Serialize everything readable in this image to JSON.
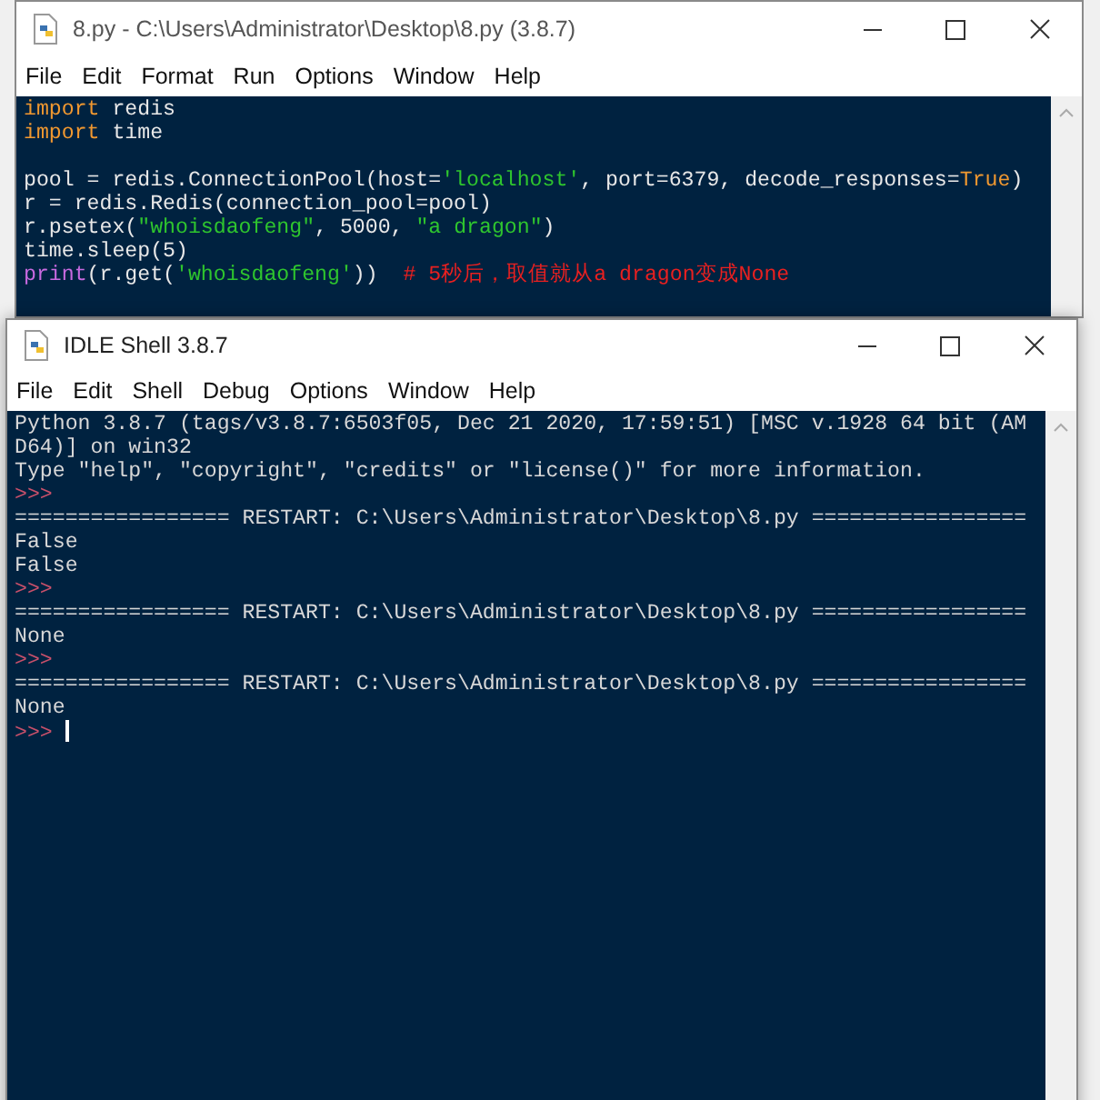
{
  "editor_window": {
    "title": "8.py - C:\\Users\\Administrator\\Desktop\\8.py (3.8.7)",
    "menu": [
      "File",
      "Edit",
      "Format",
      "Run",
      "Options",
      "Window",
      "Help"
    ],
    "code_lines": [
      {
        "kind": "code",
        "tokens": [
          {
            "kind": "keyword",
            "text": "import"
          },
          {
            "kind": "plain",
            "text": " redis"
          }
        ]
      },
      {
        "kind": "code",
        "tokens": [
          {
            "kind": "keyword",
            "text": "import"
          },
          {
            "kind": "plain",
            "text": " time"
          }
        ]
      },
      {
        "kind": "blank"
      },
      {
        "kind": "code",
        "tokens": [
          {
            "kind": "plain",
            "text": "pool = redis.ConnectionPool(host="
          },
          {
            "kind": "string",
            "text": "'localhost'"
          },
          {
            "kind": "plain",
            "text": ", port=6379, decode_responses="
          },
          {
            "kind": "keyword",
            "text": "True"
          },
          {
            "kind": "plain",
            "text": ")"
          }
        ]
      },
      {
        "kind": "code",
        "tokens": [
          {
            "kind": "plain",
            "text": "r = redis.Redis(connection_pool=pool)"
          }
        ]
      },
      {
        "kind": "code",
        "tokens": [
          {
            "kind": "plain",
            "text": "r.psetex("
          },
          {
            "kind": "string",
            "text": "\"whoisdaofeng\""
          },
          {
            "kind": "plain",
            "text": ", 5000, "
          },
          {
            "kind": "string",
            "text": "\"a dragon\""
          },
          {
            "kind": "plain",
            "text": ")"
          }
        ]
      },
      {
        "kind": "code",
        "tokens": [
          {
            "kind": "plain",
            "text": "time.sleep(5)"
          }
        ]
      },
      {
        "kind": "code",
        "tokens": [
          {
            "kind": "builtin",
            "text": "print"
          },
          {
            "kind": "plain",
            "text": "(r.get("
          },
          {
            "kind": "string",
            "text": "'whoisdaofeng'"
          },
          {
            "kind": "plain",
            "text": "))  "
          },
          {
            "kind": "comment",
            "text": "# 5秒后，取值就从a dragon变成None"
          }
        ]
      }
    ]
  },
  "shell_window": {
    "title": "IDLE Shell 3.8.7",
    "menu": [
      "File",
      "Edit",
      "Shell",
      "Debug",
      "Options",
      "Window",
      "Help"
    ],
    "lines": [
      {
        "kind": "output",
        "text": "Python 3.8.7 (tags/v3.8.7:6503f05, Dec 21 2020, 17:59:51) [MSC v.1928 64 bit (AM"
      },
      {
        "kind": "output",
        "text": "D64)] on win32"
      },
      {
        "kind": "output",
        "text": "Type \"help\", \"copyright\", \"credits\" or \"license()\" for more information."
      },
      {
        "kind": "prompt",
        "text": ">>>"
      },
      {
        "kind": "output",
        "text": "================= RESTART: C:\\Users\\Administrator\\Desktop\\8.py ================="
      },
      {
        "kind": "output",
        "text": "False"
      },
      {
        "kind": "output",
        "text": "False"
      },
      {
        "kind": "prompt",
        "text": ">>>"
      },
      {
        "kind": "output",
        "text": "================= RESTART: C:\\Users\\Administrator\\Desktop\\8.py ================="
      },
      {
        "kind": "output",
        "text": "None"
      },
      {
        "kind": "prompt",
        "text": ">>>"
      },
      {
        "kind": "output",
        "text": "================= RESTART: C:\\Users\\Administrator\\Desktop\\8.py ================="
      },
      {
        "kind": "output",
        "text": "None"
      },
      {
        "kind": "cursor_prompt",
        "text": ">>>"
      }
    ]
  }
}
